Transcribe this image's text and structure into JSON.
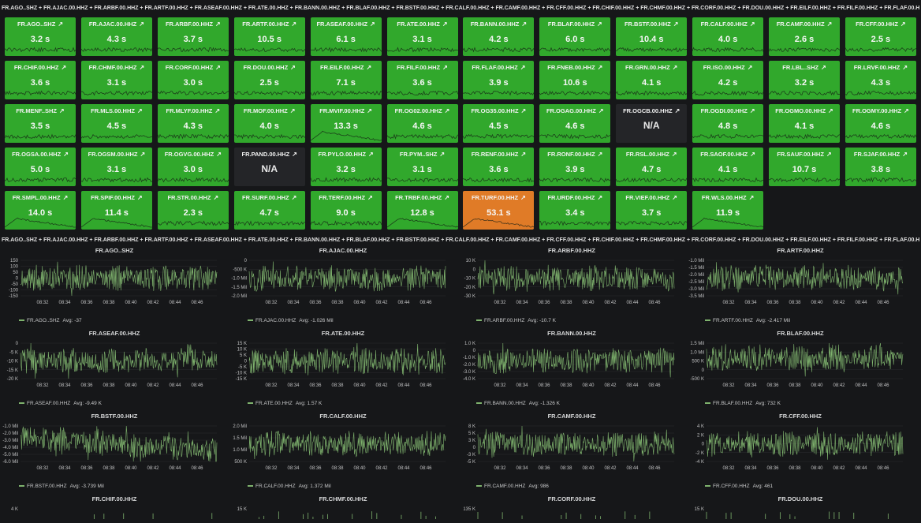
{
  "top_row_title": "FR.AGO..SHZ + FR.AJAC.00.HHZ + FR.ARBF.00.HHZ + FR.ARTF.00.HHZ + FR.ASEAF.00.HHZ + FR.ATE.00.HHZ + FR.BANN.00.HHZ + FR.BLAF.00.HHZ + FR.BSTF.00.HHZ + FR.CALF.00.HHZ + FR.CAMF.00.HHZ + FR.CFF.00.HHZ + FR.CHIF.00.HHZ + FR.CHMF.00.HHZ + FR.CORF.00.HHZ + FR.DOU.00.HHZ + FR.EILF.00.HHZ + FR.FILF.00.HHZ + FR.FLAF.00.HHZ + FR.FNEB.00.HHZ + F",
  "second_row_title": "FR.AGO..SHZ + FR.AJAC.00.HHZ + FR.ARBF.00.HHZ + FR.ARTF.00.HHZ + FR.ASEAF.00.HHZ + FR.ATE.00.HHZ + FR.BANN.00.HHZ + FR.BLAF.00.HHZ + FR.BSTF.00.HHZ + FR.CALF.00.HHZ + FR.CAMF.00.HHZ + FR.CFF.00.HHZ + FR.CHIF.00.HHZ + FR.CHMF.00.HHZ + FR.CORF.00.HHZ + FR.DOU.00.HHZ + FR.EILF.00.HHZ + FR.FILF.00.HHZ + FR.FLAF.00.HHZ + FR.FNEB.00.HHZ + F",
  "link_icon": "external-link-icon",
  "colors": {
    "ok": "#31a82c",
    "warn": "#e07b27",
    "na": "#242528",
    "series": "#7eb26d"
  },
  "stat_panels": [
    {
      "title": "FR.AGO..SHZ",
      "value": "3.2 s",
      "status": "ok"
    },
    {
      "title": "FR.AJAC.00.HHZ",
      "value": "4.3 s",
      "status": "ok"
    },
    {
      "title": "FR.ARBF.00.HHZ",
      "value": "3.7 s",
      "status": "ok"
    },
    {
      "title": "FR.ARTF.00.HHZ",
      "value": "10.5 s",
      "status": "ok"
    },
    {
      "title": "FR.ASEAF.00.HHZ",
      "value": "6.1 s",
      "status": "ok"
    },
    {
      "title": "FR.ATE.00.HHZ",
      "value": "3.1 s",
      "status": "ok"
    },
    {
      "title": "FR.BANN.00.HHZ",
      "value": "4.2 s",
      "status": "ok"
    },
    {
      "title": "FR.BLAF.00.HHZ",
      "value": "6.0 s",
      "status": "ok"
    },
    {
      "title": "FR.BSTF.00.HHZ",
      "value": "10.4 s",
      "status": "ok"
    },
    {
      "title": "FR.CALF.00.HHZ",
      "value": "4.0 s",
      "status": "ok"
    },
    {
      "title": "FR.CAMF.00.HHZ",
      "value": "2.6 s",
      "status": "ok"
    },
    {
      "title": "FR.CFF.00.HHZ",
      "value": "2.5 s",
      "status": "ok"
    },
    {
      "title": "FR.CHIF.00.HHZ",
      "value": "3.6 s",
      "status": "ok"
    },
    {
      "title": "FR.CHMF.00.HHZ",
      "value": "3.1 s",
      "status": "ok"
    },
    {
      "title": "FR.CORF.00.HHZ",
      "value": "3.0 s",
      "status": "ok"
    },
    {
      "title": "FR.DOU.00.HHZ",
      "value": "2.5 s",
      "status": "ok"
    },
    {
      "title": "FR.EILF.00.HHZ",
      "value": "7.1 s",
      "status": "ok"
    },
    {
      "title": "FR.FILF.00.HHZ",
      "value": "3.6 s",
      "status": "ok"
    },
    {
      "title": "FR.FLAF.00.HHZ",
      "value": "3.9 s",
      "status": "ok"
    },
    {
      "title": "FR.FNEB.00.HHZ",
      "value": "10.6 s",
      "status": "ok"
    },
    {
      "title": "FR.GRN.00.HHZ",
      "value": "4.1 s",
      "status": "ok"
    },
    {
      "title": "FR.ISO.00.HHZ",
      "value": "4.2 s",
      "status": "ok"
    },
    {
      "title": "FR.LBL..SHZ",
      "value": "3.2 s",
      "status": "ok"
    },
    {
      "title": "FR.LRVF.00.HHZ",
      "value": "4.3 s",
      "status": "ok"
    },
    {
      "title": "FR.MENF..SHZ",
      "value": "3.5 s",
      "status": "ok"
    },
    {
      "title": "FR.MLS.00.HHZ",
      "value": "4.5 s",
      "status": "ok"
    },
    {
      "title": "FR.MLYF.00.HHZ",
      "value": "4.3 s",
      "status": "ok"
    },
    {
      "title": "FR.MOF.00.HHZ",
      "value": "4.0 s",
      "status": "ok"
    },
    {
      "title": "FR.MVIF.00.HHZ",
      "value": "13.3 s",
      "status": "ok"
    },
    {
      "title": "FR.OG02.00.HHZ",
      "value": "4.6 s",
      "status": "ok"
    },
    {
      "title": "FR.OG35.00.HHZ",
      "value": "4.5 s",
      "status": "ok"
    },
    {
      "title": "FR.OGAG.00.HHZ",
      "value": "4.6 s",
      "status": "ok"
    },
    {
      "title": "FR.OGCB.00.HHZ",
      "value": "N/A",
      "status": "na"
    },
    {
      "title": "FR.OGDI.00.HHZ",
      "value": "4.8 s",
      "status": "ok"
    },
    {
      "title": "FR.OGMO.00.HHZ",
      "value": "4.1 s",
      "status": "ok"
    },
    {
      "title": "FR.OGMY.00.HHZ",
      "value": "4.6 s",
      "status": "ok"
    },
    {
      "title": "FR.OGSA.00.HHZ",
      "value": "5.0 s",
      "status": "ok"
    },
    {
      "title": "FR.OGSM.00.HHZ",
      "value": "3.1 s",
      "status": "ok"
    },
    {
      "title": "FR.OGVG.00.HHZ",
      "value": "3.0 s",
      "status": "ok"
    },
    {
      "title": "FR.PAND.00.HHZ",
      "value": "N/A",
      "status": "na"
    },
    {
      "title": "FR.PYLO.00.HHZ",
      "value": "3.2 s",
      "status": "ok"
    },
    {
      "title": "FR.PYM..SHZ",
      "value": "3.1 s",
      "status": "ok"
    },
    {
      "title": "FR.RENF.00.HHZ",
      "value": "3.6 s",
      "status": "ok"
    },
    {
      "title": "FR.RONF.00.HHZ",
      "value": "3.9 s",
      "status": "ok"
    },
    {
      "title": "FR.RSL.00.HHZ",
      "value": "4.7 s",
      "status": "ok"
    },
    {
      "title": "FR.SAOF.00.HHZ",
      "value": "4.1 s",
      "status": "ok"
    },
    {
      "title": "FR.SAUF.00.HHZ",
      "value": "10.7 s",
      "status": "ok"
    },
    {
      "title": "FR.SJAF.00.HHZ",
      "value": "3.8 s",
      "status": "ok"
    },
    {
      "title": "FR.SMPL.00.HHZ",
      "value": "14.0 s",
      "status": "ok"
    },
    {
      "title": "FR.SPIF.00.HHZ",
      "value": "11.4 s",
      "status": "ok"
    },
    {
      "title": "FR.STR.00.HHZ",
      "value": "2.3 s",
      "status": "ok"
    },
    {
      "title": "FR.SURF.00.HHZ",
      "value": "4.7 s",
      "status": "ok"
    },
    {
      "title": "FR.TERF.00.HHZ",
      "value": "9.0 s",
      "status": "ok"
    },
    {
      "title": "FR.TRBF.00.HHZ",
      "value": "12.8 s",
      "status": "ok"
    },
    {
      "title": "FR.TURF.00.HHZ",
      "value": "53.1 s",
      "status": "warn"
    },
    {
      "title": "FR.URDF.00.HHZ",
      "value": "3.4 s",
      "status": "ok"
    },
    {
      "title": "FR.VIEF.00.HHZ",
      "value": "3.7 s",
      "status": "ok"
    },
    {
      "title": "FR.WLS.00.HHZ",
      "value": "11.9 s",
      "status": "ok"
    }
  ],
  "chart_data": [
    {
      "type": "line",
      "title": "FR.AGO..SHZ",
      "x_ticks": [
        "08:32",
        "08:34",
        "08:36",
        "08:38",
        "08:40",
        "08:42",
        "08:44",
        "08:46"
      ],
      "y_ticks": [
        "150",
        "100",
        "50",
        "0",
        "-50",
        "-100",
        "-150"
      ],
      "ylim": [
        -150,
        150
      ],
      "series": [
        {
          "name": "FR.AGO..SHZ",
          "avg": "Avg: -37"
        }
      ]
    },
    {
      "type": "line",
      "title": "FR.AJAC.00.HHZ",
      "x_ticks": [
        "08:32",
        "08:34",
        "08:36",
        "08:38",
        "08:40",
        "08:42",
        "08:44",
        "08:46"
      ],
      "y_ticks": [
        "0",
        "-500 K",
        "-1.0 Mil",
        "-1.5 Mil",
        "-2.0 Mil"
      ],
      "ylim": [
        -2000000,
        0
      ],
      "series": [
        {
          "name": "FR.AJAC.00.HHZ",
          "avg": "Avg: -1.026 Mil"
        }
      ]
    },
    {
      "type": "line",
      "title": "FR.ARBF.00.HHZ",
      "x_ticks": [
        "08:32",
        "08:34",
        "08:36",
        "08:38",
        "08:40",
        "08:42",
        "08:44",
        "08:46"
      ],
      "y_ticks": [
        "10 K",
        "0",
        "-10 K",
        "-20 K",
        "-30 K"
      ],
      "ylim": [
        -30000,
        10000
      ],
      "series": [
        {
          "name": "FR.ARBF.00.HHZ",
          "avg": "Avg: -10.7 K"
        }
      ]
    },
    {
      "type": "line",
      "title": "FR.ARTF.00.HHZ",
      "x_ticks": [
        "08:32",
        "08:34",
        "08:36",
        "08:38",
        "08:40",
        "08:42",
        "08:44",
        "08:46"
      ],
      "y_ticks": [
        "-1.0 Mil",
        "-1.5 Mil",
        "-2.0 Mil",
        "-2.5 Mil",
        "-3.0 Mil",
        "-3.5 Mil"
      ],
      "ylim": [
        -3500000,
        -1000000
      ],
      "series": [
        {
          "name": "FR.ARTF.00.HHZ",
          "avg": "Avg: -2.417 Mil"
        }
      ]
    },
    {
      "type": "line",
      "title": "FR.ASEAF.00.HHZ",
      "x_ticks": [
        "08:32",
        "08:34",
        "08:36",
        "08:38",
        "08:40",
        "08:42",
        "08:44",
        "08:46"
      ],
      "y_ticks": [
        "0",
        "-5 K",
        "-10 K",
        "-15 K",
        "-20 K"
      ],
      "ylim": [
        -20000,
        0
      ],
      "series": [
        {
          "name": "FR.ASEAF.00.HHZ",
          "avg": "Avg: -9.49 K"
        }
      ]
    },
    {
      "type": "line",
      "title": "FR.ATE.00.HHZ",
      "x_ticks": [
        "08:32",
        "08:34",
        "08:36",
        "08:38",
        "08:40",
        "08:42",
        "08:44",
        "08:46"
      ],
      "y_ticks": [
        "15 K",
        "10 K",
        "5 K",
        "0",
        "-5 K",
        "-10 K",
        "-15 K"
      ],
      "ylim": [
        -15000,
        15000
      ],
      "series": [
        {
          "name": "FR.ATE.00.HHZ",
          "avg": "Avg: 1.57 K"
        }
      ]
    },
    {
      "type": "line",
      "title": "FR.BANN.00.HHZ",
      "x_ticks": [
        "08:32",
        "08:34",
        "08:36",
        "08:38",
        "08:40",
        "08:42",
        "08:44",
        "08:46"
      ],
      "y_ticks": [
        "1.0 K",
        "0",
        "-1.0 K",
        "-2.0 K",
        "-3.0 K",
        "-4.0 K"
      ],
      "ylim": [
        -4000,
        1000
      ],
      "series": [
        {
          "name": "FR.BANN.00.HHZ",
          "avg": "Avg: -1.326 K"
        }
      ]
    },
    {
      "type": "line",
      "title": "FR.BLAF.00.HHZ",
      "x_ticks": [
        "08:32",
        "08:34",
        "08:36",
        "08:38",
        "08:40",
        "08:42",
        "08:44",
        "08:46"
      ],
      "y_ticks": [
        "1.5 Mil",
        "1.0 Mil",
        "500 K",
        "0",
        "-500 K"
      ],
      "ylim": [
        -500000,
        1500000
      ],
      "series": [
        {
          "name": "FR.BLAF.00.HHZ",
          "avg": "Avg: 732 K"
        }
      ]
    },
    {
      "type": "line",
      "title": "FR.BSTF.00.HHZ",
      "x_ticks": [
        "08:32",
        "08:34",
        "08:36",
        "08:38",
        "08:40",
        "08:42",
        "08:44",
        "08:46"
      ],
      "y_ticks": [
        "-1.0 Mil",
        "-2.0 Mil",
        "-3.0 Mil",
        "-4.0 Mil",
        "-5.0 Mil",
        "-6.0 Mil"
      ],
      "ylim": [
        -6000000,
        -1000000
      ],
      "series": [
        {
          "name": "FR.BSTF.00.HHZ",
          "avg": "Avg: -3.739 Mil"
        }
      ]
    },
    {
      "type": "line",
      "title": "FR.CALF.00.HHZ",
      "x_ticks": [
        "08:32",
        "08:34",
        "08:36",
        "08:38",
        "08:40",
        "08:42",
        "08:44",
        "08:46"
      ],
      "y_ticks": [
        "2.0 Mil",
        "1.5 Mil",
        "1.0 Mil",
        "500 K"
      ],
      "ylim": [
        500000,
        2000000
      ],
      "series": [
        {
          "name": "FR.CALF.00.HHZ",
          "avg": "Avg: 1.372 Mil"
        }
      ]
    },
    {
      "type": "line",
      "title": "FR.CAMF.00.HHZ",
      "x_ticks": [
        "08:32",
        "08:34",
        "08:36",
        "08:38",
        "08:40",
        "08:42",
        "08:44",
        "08:46"
      ],
      "y_ticks": [
        "8 K",
        "5 K",
        "3 K",
        "0",
        "-3 K",
        "-5 K"
      ],
      "ylim": [
        -5000,
        8000
      ],
      "series": [
        {
          "name": "FR.CAMF.00.HHZ",
          "avg": "Avg: 986"
        }
      ]
    },
    {
      "type": "line",
      "title": "FR.CFF.00.HHZ",
      "x_ticks": [
        "08:32",
        "08:34",
        "08:36",
        "08:38",
        "08:40",
        "08:42",
        "08:44",
        "08:46"
      ],
      "y_ticks": [
        "4 K",
        "2 K",
        "0",
        "-2 K",
        "-4 K"
      ],
      "ylim": [
        -4000,
        4000
      ],
      "series": [
        {
          "name": "FR.CFF.00.HHZ",
          "avg": "Avg: 461"
        }
      ]
    },
    {
      "type": "line",
      "title": "FR.CHIF.00.HHZ",
      "y_ticks": [
        "4 K"
      ],
      "series": []
    },
    {
      "type": "line",
      "title": "FR.CHMF.00.HHZ",
      "y_ticks": [
        "15 K"
      ],
      "series": []
    },
    {
      "type": "line",
      "title": "FR.CORF.00.HHZ",
      "y_ticks": [
        "135 K"
      ],
      "series": []
    },
    {
      "type": "line",
      "title": "FR.DOU.00.HHZ",
      "y_ticks": [
        "15 K",
        "10 K"
      ],
      "series": []
    }
  ]
}
